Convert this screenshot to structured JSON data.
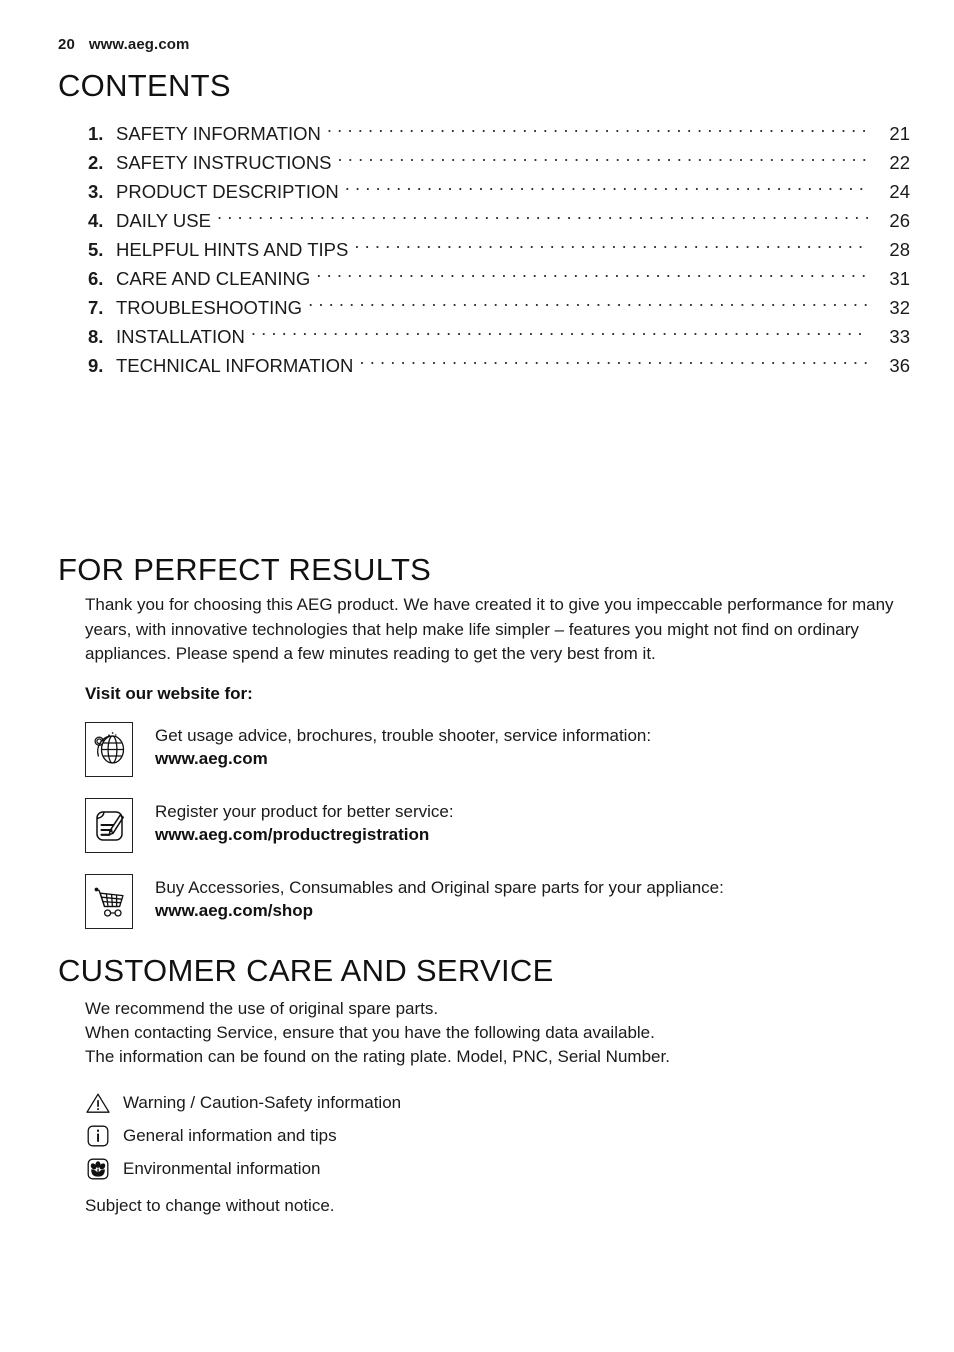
{
  "header": {
    "page_number": "20",
    "website": "www.aeg.com"
  },
  "contents": {
    "heading": "CONTENTS",
    "entries": [
      {
        "num": "1.",
        "title": "SAFETY INFORMATION",
        "page": "21"
      },
      {
        "num": "2.",
        "title": "SAFETY INSTRUCTIONS",
        "page": "22"
      },
      {
        "num": "3.",
        "title": "PRODUCT DESCRIPTION",
        "page": "24"
      },
      {
        "num": "4.",
        "title": "DAILY USE",
        "page": "26"
      },
      {
        "num": "5.",
        "title": "HELPFUL HINTS AND TIPS",
        "page": "28"
      },
      {
        "num": "6.",
        "title": "CARE AND CLEANING",
        "page": "31"
      },
      {
        "num": "7.",
        "title": "TROUBLESHOOTING",
        "page": "32"
      },
      {
        "num": "8.",
        "title": "INSTALLATION",
        "page": "33"
      },
      {
        "num": "9.",
        "title": "TECHNICAL INFORMATION",
        "page": "36"
      }
    ]
  },
  "perfect_results": {
    "heading": "FOR PERFECT RESULTS",
    "paragraph": "Thank you for choosing this AEG product. We have created it to give you impeccable performance for many years, with innovative technologies that help make life simpler – features you might not find on ordinary appliances. Please spend a few minutes reading to get the very best from it.",
    "visit_label": "Visit our website for:",
    "links": [
      {
        "icon": "globe-at-icon",
        "description": "Get usage advice, brochures, trouble shooter, service information:",
        "url": "www.aeg.com"
      },
      {
        "icon": "document-pencil-icon",
        "description": "Register your product for better service:",
        "url": "www.aeg.com/productregistration"
      },
      {
        "icon": "shopping-cart-icon",
        "description": "Buy Accessories, Consumables and Original spare parts for your appliance:",
        "url": "www.aeg.com/shop"
      }
    ]
  },
  "customer_care": {
    "heading": "CUSTOMER CARE AND SERVICE",
    "lines": [
      "We recommend the use of original spare parts.",
      "When contacting Service, ensure that you have the following data available.",
      "The information can be found on the rating plate. Model, PNC, Serial Number."
    ],
    "legend": [
      {
        "icon": "warning-triangle-icon",
        "label": "Warning / Caution-Safety information"
      },
      {
        "icon": "info-icon",
        "label": "General information and tips"
      },
      {
        "icon": "environment-flower-icon",
        "label": "Environmental information"
      }
    ],
    "notice": "Subject to change without notice."
  },
  "colors": {
    "text": "#1a1a1a",
    "background": "#ffffff",
    "rule": "#222222"
  }
}
